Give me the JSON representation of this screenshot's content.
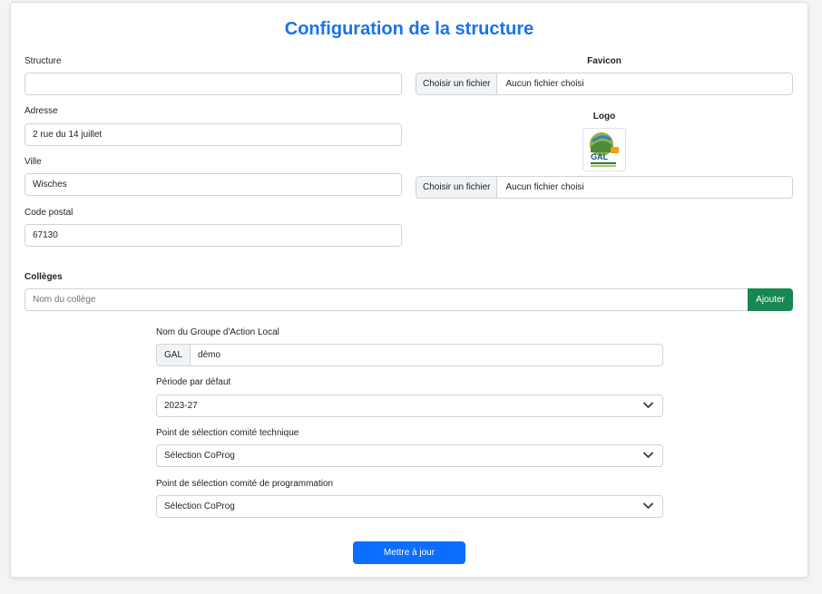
{
  "page": {
    "title": "Configuration de la structure"
  },
  "form": {
    "structure": {
      "label": "Structure",
      "value": ""
    },
    "adresse": {
      "label": "Adresse",
      "value": "2 rue du 14 juillet"
    },
    "ville": {
      "label": "Ville",
      "value": "Wisches"
    },
    "code_postal": {
      "label": "Code postal",
      "value": "67130"
    }
  },
  "favicon": {
    "label": "Favicon",
    "button": "Choisir un fichier",
    "status": "Aucun fichier choisi"
  },
  "logo": {
    "label": "Logo",
    "image_text": "GAL",
    "button": "Choisir un fichier",
    "status": "Aucun fichier choisi"
  },
  "colleges": {
    "label": "Collèges",
    "placeholder": "Nom du collège",
    "add_button": "Ajouter"
  },
  "gal": {
    "label": "Nom du Groupe d'Action Local",
    "prefix": "GAL",
    "value": "démo"
  },
  "periode": {
    "label": "Période par défaut",
    "selected": "2023-27"
  },
  "comite_technique": {
    "label": "Point de sélection comité technique",
    "selected": "Sélection CoProg"
  },
  "comite_programmation": {
    "label": "Point de sélection comité de programmation",
    "selected": "Sélection CoProg"
  },
  "submit": {
    "label": "Mettre à jour"
  },
  "colors": {
    "title": "#1a73e8",
    "primary_button": "#0d6efd",
    "success_button": "#198754"
  }
}
